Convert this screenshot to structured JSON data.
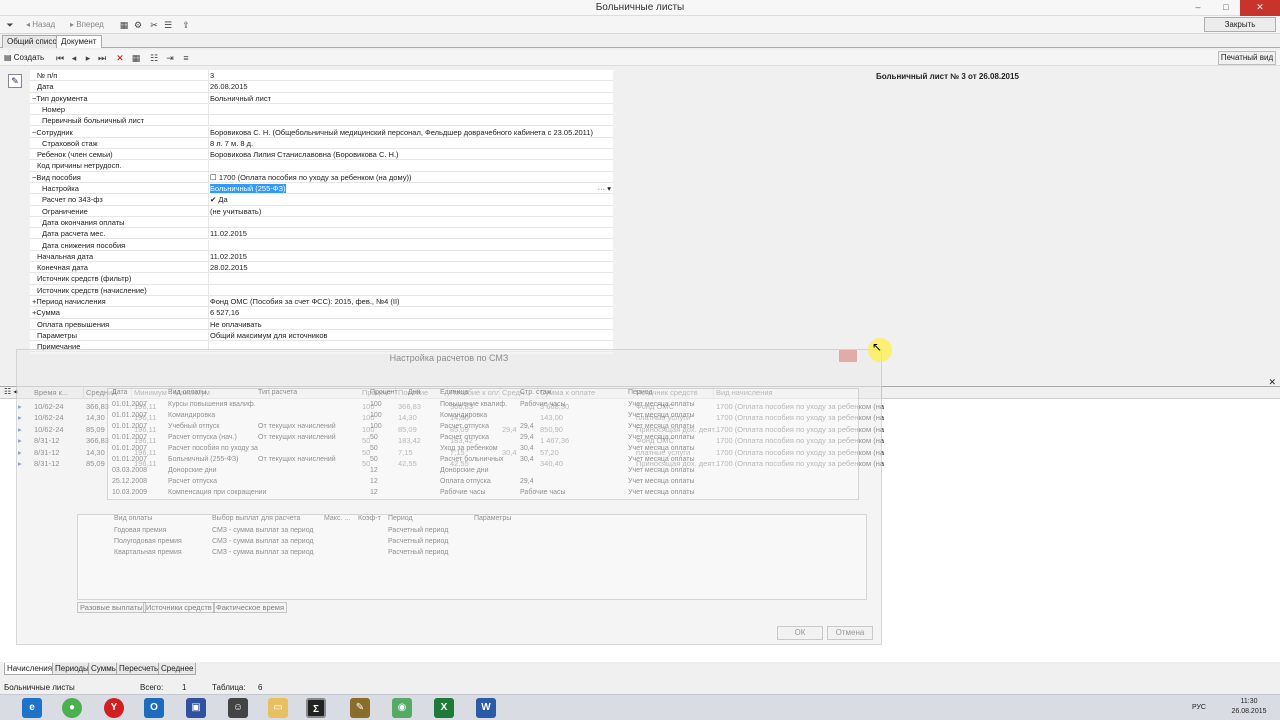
{
  "window": {
    "title": "Больничные листы",
    "min": "–",
    "max": "□",
    "close": "✕"
  },
  "nav": {
    "back": "Назад",
    "forward": "Вперед",
    "close": "Закрыть"
  },
  "tabs": [
    "Общий список",
    "Документ"
  ],
  "toolbar": {
    "create": "Создать",
    "print_view": "Печатный вид"
  },
  "doc_header": "Больничный лист № 3 от 26.08.2015",
  "properties": [
    {
      "name": "№ п/п",
      "value": "3",
      "indent": 1
    },
    {
      "name": "Дата",
      "value": "26.08.2015",
      "indent": 1
    },
    {
      "name": "Тип документа",
      "value": "Больничный лист",
      "indent": 0,
      "exp": "−"
    },
    {
      "name": "Номер",
      "value": "",
      "indent": 2
    },
    {
      "name": "Первичный больничный лист",
      "value": "",
      "indent": 2
    },
    {
      "name": "Сотрудник",
      "value": "Боровикова С. Н. (Общебольничный медицинский персонал, Фельдшер доврачебного кабинета с 23.05.2011)",
      "indent": 0,
      "exp": "−"
    },
    {
      "name": "Страховой стаж",
      "value": "8 л. 7 м. 8 д.",
      "indent": 2
    },
    {
      "name": "Ребенок (член семьи)",
      "value": "Боровикова Лилия Станиславовна (Боровикова С. Н.)",
      "indent": 1
    },
    {
      "name": "Код причины нетрудосп.",
      "value": "",
      "indent": 1
    },
    {
      "name": "Вид пособия",
      "value": "1700 (Оплата пособия по уходу за ребенком (на дому))",
      "indent": 0,
      "exp": "−"
    },
    {
      "name": "Настройка",
      "value": "Больничный (255-ФЗ)",
      "indent": 2,
      "selected": true
    },
    {
      "name": "Расчет по 343-фз",
      "value": "Да",
      "indent": 2,
      "check": true
    },
    {
      "name": "Ограничение",
      "value": "(не учитывать)",
      "indent": 2
    },
    {
      "name": "Дата окончания оплаты",
      "value": "",
      "indent": 2
    },
    {
      "name": "Дата расчета мес.",
      "value": "11.02.2015",
      "indent": 2
    },
    {
      "name": "Дата снижения пособия",
      "value": "",
      "indent": 2
    },
    {
      "name": "Начальная дата",
      "value": "11.02.2015",
      "indent": 1
    },
    {
      "name": "Конечная дата",
      "value": "28.02.2015",
      "indent": 1
    },
    {
      "name": "Источник средств (фильтр)",
      "value": "",
      "indent": 1
    },
    {
      "name": "Источник средств (начисление)",
      "value": "",
      "indent": 1
    },
    {
      "name": "Период начисления",
      "value": "Фонд ОМС (Пособия за счет ФСС): 2015, фев., №4 (II)",
      "indent": 0,
      "exp": "+"
    },
    {
      "name": "Сумма",
      "value": "6 527,16",
      "indent": 0,
      "exp": "+"
    },
    {
      "name": "Оплата превышения",
      "value": "Не оплачивать",
      "indent": 1
    },
    {
      "name": "Параметры",
      "value": "Общий максимум для источников",
      "indent": 1
    },
    {
      "name": "Примечание",
      "value": "",
      "indent": 1
    }
  ],
  "table": {
    "headers": [
      "Время к...",
      "Средний",
      "Минимум",
      "Максимум",
      "Процент",
      "Пособие",
      "Пособие к оплате",
      "Средн...",
      "Сумма к оплате",
      "Источник средств",
      "Вид начисления"
    ],
    "rows": [
      [
        "10/62-24",
        "366,83",
        "196,11",
        "",
        "100",
        "366,83",
        "366,83",
        "",
        "3 668,30",
        "Фонд ОМС",
        "1700 (Оплата пособия по уходу за ребенком (на..."
      ],
      [
        "10/62-24",
        "14,30",
        "196,11",
        "",
        "100",
        "14,30",
        "14,30",
        "",
        "143,00",
        "платные услуги",
        "1700 (Оплата пособия по уходу за ребенком (на..."
      ],
      [
        "10/62-24",
        "85,09",
        "196,11",
        "",
        "100",
        "85,09",
        "85,09",
        "29,4",
        "850,90",
        "Приносящая дох. деят.",
        "1700 (Оплата пособия по уходу за ребенком (на..."
      ],
      [
        "8/31-12",
        "366,83",
        "196,11",
        "",
        "50",
        "183,42",
        "183,42",
        "",
        "1 467,36",
        "Фонд ОМС",
        "1700 (Оплата пособия по уходу за ребенком (на..."
      ],
      [
        "8/31-12",
        "14,30",
        "196,11",
        "",
        "50",
        "7,15",
        "7,15",
        "30,4",
        "57,20",
        "платные услуги",
        "1700 (Оплата пособия по уходу за ребенком (на..."
      ],
      [
        "8/31-12",
        "85,09",
        "196,11",
        "",
        "50",
        "42,55",
        "42,55",
        "",
        "340,40",
        "Приносящая дох. деят.",
        "1700 (Оплата пособия по уходу за ребенком (на..."
      ]
    ]
  },
  "bottom_tabs": [
    "Начисления",
    "Периоды",
    "Суммы",
    "Пересчеты",
    "Среднее"
  ],
  "status": {
    "doc": "Больничные листы",
    "total_label": "Всего:",
    "total": "1",
    "table_label": "Таблица:",
    "table": "6"
  },
  "dialog": {
    "title": "Настройка расчетов по СМЗ",
    "top_headers": [
      "Дата",
      "Вид оплаты",
      "Тип расчета",
      "Процент",
      "Дни",
      "Единица",
      "Стр. стаж",
      "Период"
    ],
    "top_rows": [
      [
        "01.01.2007",
        "Курсы повышения квалиф.",
        "",
        "100",
        "",
        "Повышение квалиф.",
        "Рабочие часы",
        "Учет месяца оплаты"
      ],
      [
        "01.01.2007",
        "Командировка",
        "",
        "100",
        "",
        "Командировка",
        "",
        "Учет месяца оплаты"
      ],
      [
        "01.01.2007",
        "Учебный отпуск",
        "От текущих начислений",
        "100",
        "",
        "Расчет отпуска",
        "29,4",
        "Учет месяца оплаты"
      ],
      [
        "01.01.2007",
        "Расчет отпуска (нач.)",
        "От текущих начислений",
        "50",
        "",
        "Расчет отпуска",
        "29,4",
        "Учет месяца оплаты"
      ],
      [
        "01.01.2007",
        "Расчет пособия по уходу за",
        "",
        "50",
        "",
        "Уход за ребенком",
        "30,4",
        "Учет месяца оплаты"
      ],
      [
        "01.01.2007",
        "Больничный (255-ФЗ)",
        "От текущих начислений",
        "50",
        "",
        "Расчет больничных",
        "30,4",
        "Учет месяца оплаты"
      ],
      [
        "03.03.2008",
        "Донорские дни",
        "",
        "12",
        "",
        "Донорские дни",
        "",
        "Учет месяца оплаты"
      ],
      [
        "25.12.2008",
        "Расчет отпуска",
        "",
        "12",
        "",
        "Оплата отпуска",
        "29,4",
        "Учет месяца оплаты"
      ],
      [
        "10.03.2009",
        "Компенсация при сокращении",
        "",
        "12",
        "",
        "Рабочие часы",
        "Рабочие часы",
        "Учет месяца оплаты"
      ]
    ],
    "sub_headers": [
      "Вид оплаты",
      "Выбор выплат для расчета",
      "Макс. ...",
      "Коэф-т",
      "Период",
      "Параметры"
    ],
    "sub_rows": [
      [
        "Годовая премия",
        "СМЗ - сумма выплат за период",
        "",
        "",
        "Расчетный период"
      ],
      [
        "Полугодовая премия",
        "СМЗ - сумма выплат за период",
        "",
        "",
        "Расчетный период"
      ],
      [
        "Квартальная премия",
        "СМЗ - сумма выплат за период",
        "",
        "",
        "Расчетный период"
      ]
    ],
    "tabs": [
      "Разовые выплаты",
      "Источники средств",
      "Фактическое время"
    ],
    "ok": "ОК",
    "cancel": "Отмена"
  },
  "taskbar": {
    "lang": "РУС",
    "time": "11:30",
    "date": "26.08.2015"
  }
}
